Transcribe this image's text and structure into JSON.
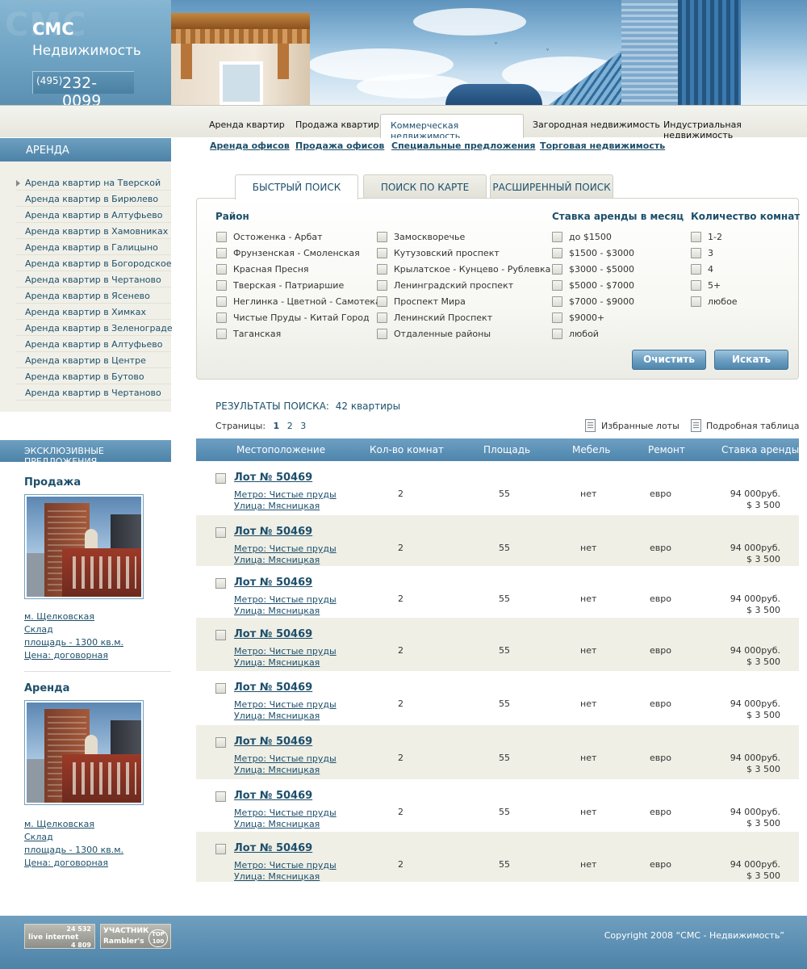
{
  "header": {
    "logo_title": "СМС",
    "logo_subtitle": "Недвижимость",
    "phone_code": "(495)",
    "phone_number": "232-0099"
  },
  "nav": {
    "items": [
      "Аренда квартир",
      "Продажа квартир",
      "Коммерческая недвижимость",
      "Загородная недвижимость",
      "Индустриальная недвижимость"
    ],
    "active": "Коммерческая недвижимость"
  },
  "subnav": [
    "Аренда офисов",
    "Продажа офисов",
    "Специальные предложения",
    "Торговая недвижимость"
  ],
  "sidebar": {
    "title": "АРЕНДА",
    "items": [
      "Аренда квартир на Тверской",
      "Аренда квартир в Бирюлево",
      "Аренда квартир в Алтуфьево",
      "Аренда квартир в Хамовниках",
      "Аренда квартир в Галицыно",
      "Аренда квартир в Богородское",
      "Аренда квартир в Чертаново",
      "Аренда квартир в Ясенево",
      "Аренда квартир в Химках",
      "Аренда квартир в Зеленограде",
      "Аренда квартир в Алтуфьево",
      "Аренда квартир в Центре",
      "Аренда квартир в Бутово",
      "Аренда квартир в Чертаново"
    ],
    "exclusive_title": "ЭКСКЛЮЗИВНЫЕ ПРЕДЛОЖЕНИЯ",
    "offers": [
      {
        "title": "Продажа",
        "metro": "м. Щелковская",
        "type": "Склад",
        "area": "площадь - 1300 кв.м.",
        "price": "Цена: договорная"
      },
      {
        "title": "Аренда",
        "metro": "м. Щелковская",
        "type": "Склад",
        "area": "площадь - 1300 кв.м.",
        "price": "Цена: договорная"
      }
    ]
  },
  "search": {
    "tabs": [
      "БЫСТРЫЙ ПОИСК",
      "ПОИСК ПО КАРТЕ",
      "РАСШИРЕННЫЙ ПОИСК"
    ],
    "active_tab": "БЫСТРЫЙ ПОИСК",
    "district_heading": "Район",
    "districts_col1": [
      "Остоженка - Арбат",
      "Фрунзенская - Смоленская",
      "Красная Пресня",
      "Тверская - Патриаршие",
      "Неглинка - Цветной - Самотека",
      "Чистые Пруды - Китай Город",
      "Таганская"
    ],
    "districts_col2": [
      "Замоскворечье",
      "Кутузовский проспект",
      "Крылатское - Кунцево - Рублевка",
      "Ленинградский проспект",
      "Проспект Мира",
      "Ленинский Проспект",
      "Отдаленные районы"
    ],
    "rent_heading": "Ставка аренды в месяц",
    "rent_options": [
      "до $1500",
      "$1500 - $3000",
      "$3000 - $5000",
      "$5000 - $7000",
      "$7000 - $9000",
      "$9000+",
      "любой"
    ],
    "rooms_heading": "Количество комнат",
    "rooms_options": [
      "1-2",
      "3",
      "4",
      "5+",
      "любое"
    ],
    "clear_button": "Очистить",
    "search_button": "Искать"
  },
  "results": {
    "title": "РЕЗУЛЬТАТЫ ПОИСКА:",
    "count": "42 квартиры",
    "pages_label": "Страницы:",
    "pages": [
      "1",
      "2",
      "3"
    ],
    "current_page": "1",
    "favorites_label": "Избранные лоты",
    "detailed_label": "Подробная таблица",
    "columns": [
      "Местоположение",
      "Кол-во комнат",
      "Площадь",
      "Мебель",
      "Ремонт",
      "Ставка аренды"
    ],
    "rows": [
      {
        "lot": "Лот № 50469",
        "metro": "Метро: Чистые пруды",
        "street": "Улица: Мясницкая",
        "rooms": "2",
        "area": "55",
        "furniture": "нет",
        "repair": "евро",
        "price_rub": "94 000руб.",
        "price_usd": "$ 3 500"
      },
      {
        "lot": "Лот № 50469",
        "metro": "Метро: Чистые пруды",
        "street": "Улица: Мясницкая",
        "rooms": "2",
        "area": "55",
        "furniture": "нет",
        "repair": "евро",
        "price_rub": "94 000руб.",
        "price_usd": "$ 3 500"
      },
      {
        "lot": "Лот № 50469",
        "metro": "Метро: Чистые пруды",
        "street": "Улица: Мясницкая",
        "rooms": "2",
        "area": "55",
        "furniture": "нет",
        "repair": "евро",
        "price_rub": "94 000руб.",
        "price_usd": "$ 3 500"
      },
      {
        "lot": "Лот № 50469",
        "metro": "Метро: Чистые пруды",
        "street": "Улица: Мясницкая",
        "rooms": "2",
        "area": "55",
        "furniture": "нет",
        "repair": "евро",
        "price_rub": "94 000руб.",
        "price_usd": "$ 3 500"
      },
      {
        "lot": "Лот № 50469",
        "metro": "Метро: Чистые пруды",
        "street": "Улица: Мясницкая",
        "rooms": "2",
        "area": "55",
        "furniture": "нет",
        "repair": "евро",
        "price_rub": "94 000руб.",
        "price_usd": "$ 3 500"
      },
      {
        "lot": "Лот № 50469",
        "metro": "Метро: Чистые пруды",
        "street": "Улица: Мясницкая",
        "rooms": "2",
        "area": "55",
        "furniture": "нет",
        "repair": "евро",
        "price_rub": "94 000руб.",
        "price_usd": "$ 3 500"
      },
      {
        "lot": "Лот № 50469",
        "metro": "Метро: Чистые пруды",
        "street": "Улица: Мясницкая",
        "rooms": "2",
        "area": "55",
        "furniture": "нет",
        "repair": "евро",
        "price_rub": "94 000руб.",
        "price_usd": "$ 3 500"
      },
      {
        "lot": "Лот № 50469",
        "metro": "Метро: Чистые пруды",
        "street": "Улица: Мясницкая",
        "rooms": "2",
        "area": "55",
        "furniture": "нет",
        "repair": "евро",
        "price_rub": "94 000руб.",
        "price_usd": "$ 3 500"
      }
    ]
  },
  "footer": {
    "counter1_top": "24 532",
    "counter1_label": "live internet",
    "counter1_bottom": "4 809",
    "counter2_label": "УЧАСТНИК",
    "counter2_brand": "Rambler's",
    "counter2_badge": "TOP 100",
    "copyright": "Copyright 2008 “СМС - Недвижимость”"
  },
  "colors": {
    "accent": "#4f86ad",
    "link": "#1d4f6b",
    "sidebar_bg": "#f1f0e8",
    "row_alt": "#efefe6"
  }
}
